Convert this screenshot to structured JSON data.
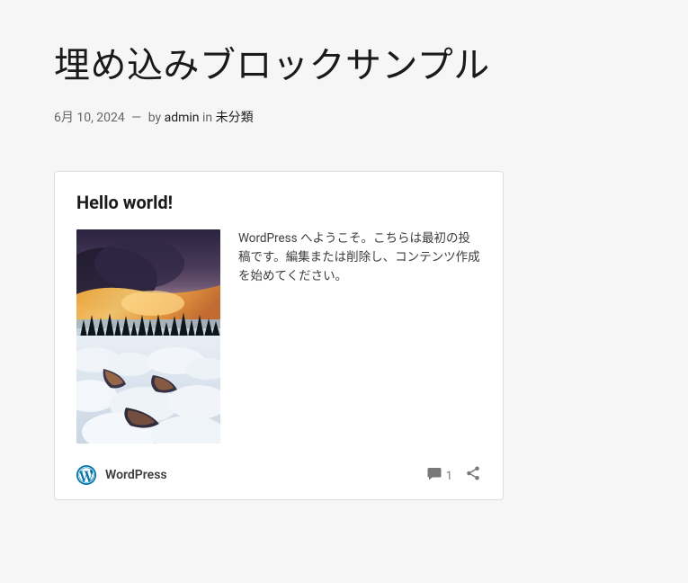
{
  "post": {
    "title": "埋め込みブロックサンプル",
    "date": "6月 10, 2024",
    "by_label": "by",
    "author": "admin",
    "in_label": "in",
    "category": "未分類"
  },
  "embed": {
    "title": "Hello world!",
    "excerpt": "WordPress へようこそ。こちらは最初の投稿です。編集または削除し、コンテンツ作成を始めてください。",
    "site_name": "WordPress",
    "comment_count": "1"
  }
}
